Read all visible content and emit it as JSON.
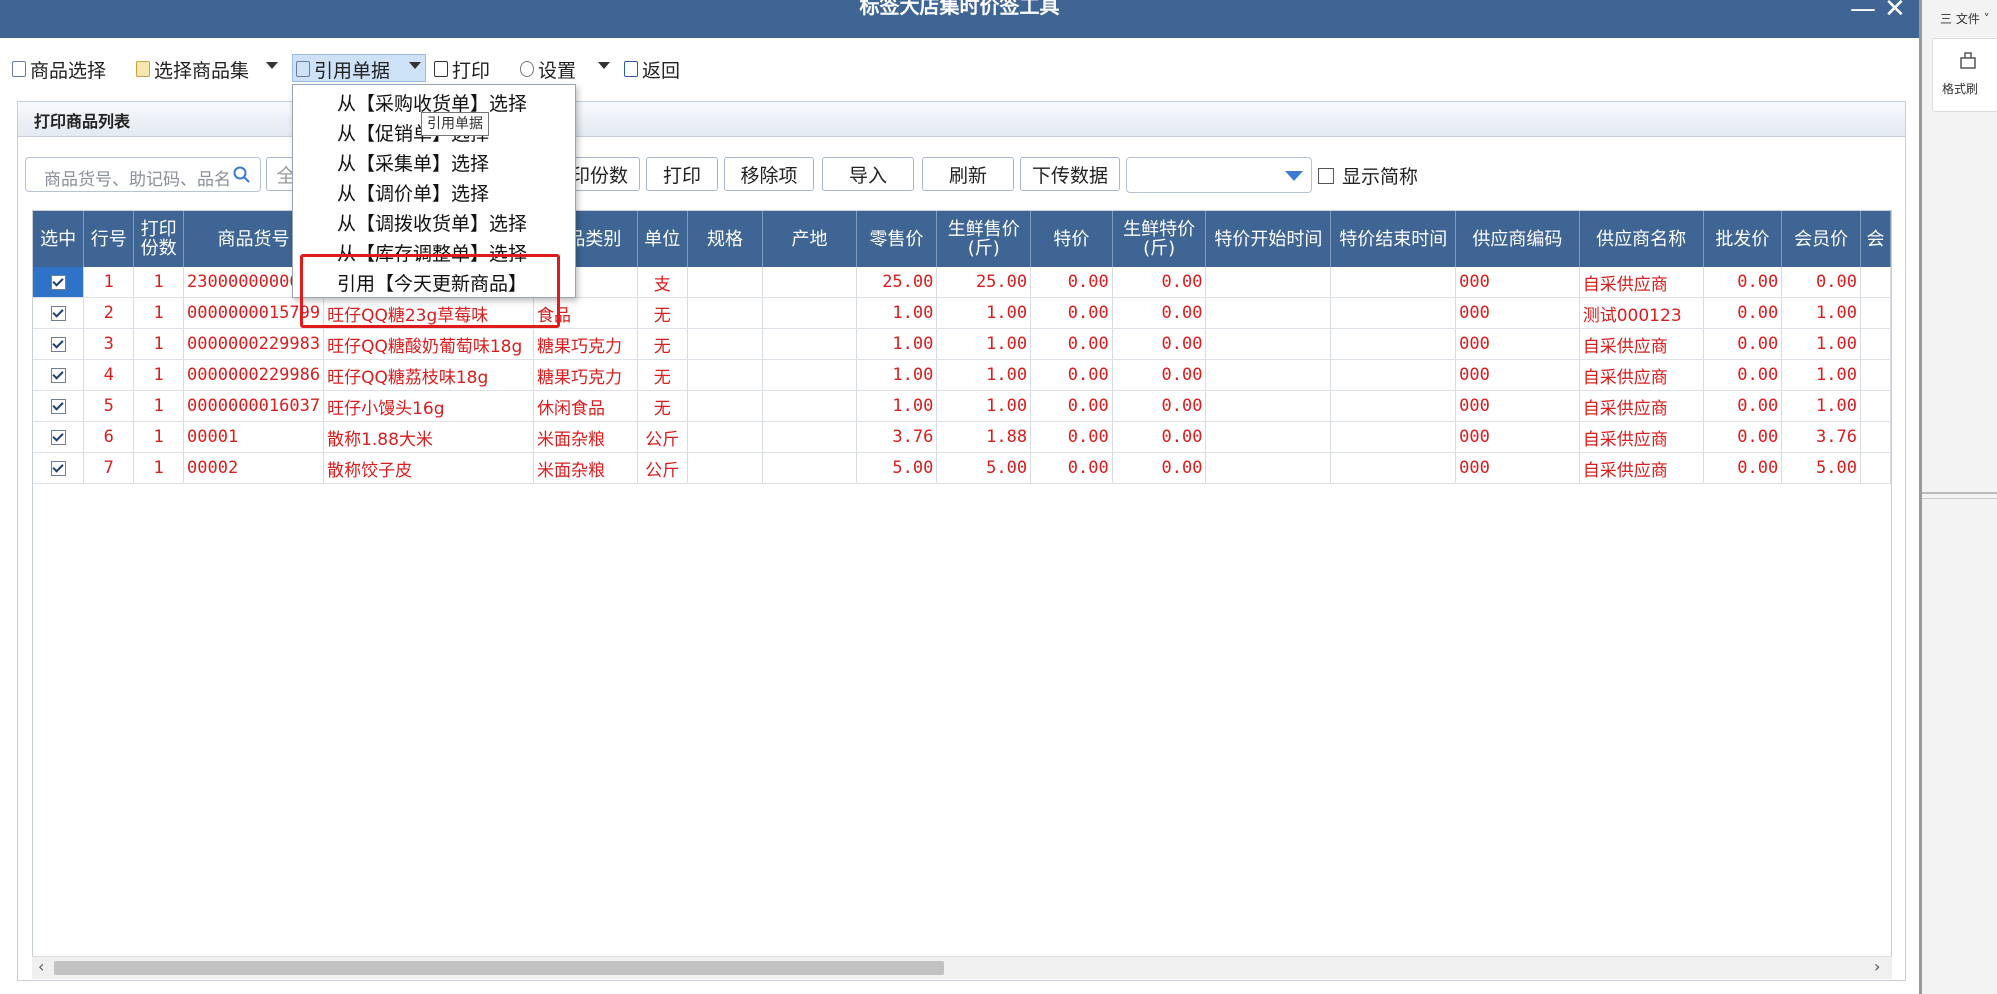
{
  "window": {
    "title": "标签大店集时价签工具",
    "min": "—",
    "close": "✕"
  },
  "toolbar": {
    "items": [
      {
        "label": "商品选择",
        "icon": "checklist-icon"
      },
      {
        "label": "选择商品集",
        "icon": "folder-icon"
      },
      {
        "label": "引用单据",
        "icon": "copy-icon"
      },
      {
        "label": "打印",
        "icon": "printer-icon"
      },
      {
        "label": "设置",
        "icon": "gear-icon"
      },
      {
        "label": "返回",
        "icon": "back-icon"
      }
    ]
  },
  "panel": {
    "title": "打印商品列表"
  },
  "filter": {
    "search_placeholder": "商品货号、助记码、品名",
    "partial_button": "全",
    "print_copies_button": "印份数",
    "print_button": "打印",
    "remove_button": "移除项",
    "import_button": "导入",
    "refresh_button": "刷新",
    "upload_button": "下传数据",
    "dropdown_value": "",
    "show_short_name_label": "显示简称"
  },
  "ref_menu": {
    "items": [
      "从【采购收货单】选择",
      "从【促销单】选择",
      "从【采集单】选择",
      "从【调价单】选择",
      "从【调拨收货单】选择",
      "从【库存调整单】选择",
      "引用【今天更新商品】"
    ],
    "tooltip": "引用单据"
  },
  "table": {
    "columns": [
      "选中",
      "行号",
      "打印\n份数",
      "商品货号",
      "品名",
      "商品类别",
      "单位",
      "规格",
      "产地",
      "零售价",
      "生鲜售价\n(斤)",
      "特价",
      "生鲜特价\n(斤)",
      "特价开始时间",
      "特价结束时间",
      "供应商编码",
      "供应商名称",
      "批发价",
      "会员价",
      "会"
    ],
    "rows": [
      {
        "no": "1",
        "copies": "1",
        "code": "2300000000000",
        "name": "",
        "category": "",
        "unit": "支",
        "spec": "",
        "origin": "",
        "retail": "25.00",
        "fresh_retail": "25.00",
        "special": "0.00",
        "fresh_special": "0.00",
        "sp_start": "",
        "sp_end": "",
        "sup_code": "000",
        "sup_name": "自采供应商",
        "wholesale": "0.00",
        "member": "0.00"
      },
      {
        "no": "2",
        "copies": "1",
        "code": "0000000015799",
        "name": "旺仔QQ糖23g草莓味",
        "category": "食品",
        "unit": "无",
        "spec": "",
        "origin": "",
        "retail": "1.00",
        "fresh_retail": "1.00",
        "special": "0.00",
        "fresh_special": "0.00",
        "sp_start": "",
        "sp_end": "",
        "sup_code": "000",
        "sup_name": "测试000123",
        "wholesale": "0.00",
        "member": "1.00"
      },
      {
        "no": "3",
        "copies": "1",
        "code": "0000000229983",
        "name": "旺仔QQ糖酸奶葡萄味18g",
        "category": "糖果巧克力",
        "unit": "无",
        "spec": "",
        "origin": "",
        "retail": "1.00",
        "fresh_retail": "1.00",
        "special": "0.00",
        "fresh_special": "0.00",
        "sp_start": "",
        "sp_end": "",
        "sup_code": "000",
        "sup_name": "自采供应商",
        "wholesale": "0.00",
        "member": "1.00"
      },
      {
        "no": "4",
        "copies": "1",
        "code": "0000000229986",
        "name": "旺仔QQ糖荔枝味18g",
        "category": "糖果巧克力",
        "unit": "无",
        "spec": "",
        "origin": "",
        "retail": "1.00",
        "fresh_retail": "1.00",
        "special": "0.00",
        "fresh_special": "0.00",
        "sp_start": "",
        "sp_end": "",
        "sup_code": "000",
        "sup_name": "自采供应商",
        "wholesale": "0.00",
        "member": "1.00"
      },
      {
        "no": "5",
        "copies": "1",
        "code": "0000000016037",
        "name": "旺仔小馒头16g",
        "category": "休闲食品",
        "unit": "无",
        "spec": "",
        "origin": "",
        "retail": "1.00",
        "fresh_retail": "1.00",
        "special": "0.00",
        "fresh_special": "0.00",
        "sp_start": "",
        "sp_end": "",
        "sup_code": "000",
        "sup_name": "自采供应商",
        "wholesale": "0.00",
        "member": "1.00"
      },
      {
        "no": "6",
        "copies": "1",
        "code": "00001",
        "name": "散称1.88大米",
        "category": "米面杂粮",
        "unit": "公斤",
        "spec": "",
        "origin": "",
        "retail": "3.76",
        "fresh_retail": "1.88",
        "special": "0.00",
        "fresh_special": "0.00",
        "sp_start": "",
        "sp_end": "",
        "sup_code": "000",
        "sup_name": "自采供应商",
        "wholesale": "0.00",
        "member": "3.76"
      },
      {
        "no": "7",
        "copies": "1",
        "code": "00002",
        "name": "散称饺子皮",
        "category": "米面杂粮",
        "unit": "公斤",
        "spec": "",
        "origin": "",
        "retail": "5.00",
        "fresh_retail": "5.00",
        "special": "0.00",
        "fresh_special": "0.00",
        "sp_start": "",
        "sp_end": "",
        "sup_code": "000",
        "sup_name": "自采供应商",
        "wholesale": "0.00",
        "member": "5.00"
      }
    ]
  },
  "right_panel": {
    "file_menu": "三 文件 ˅",
    "format_painter": "格式刷"
  },
  "colors": {
    "header_bg": "#3f6594",
    "row_text": "#d81e1e",
    "highlight": "#e01b1b",
    "selected_cell": "#2f73c9"
  }
}
